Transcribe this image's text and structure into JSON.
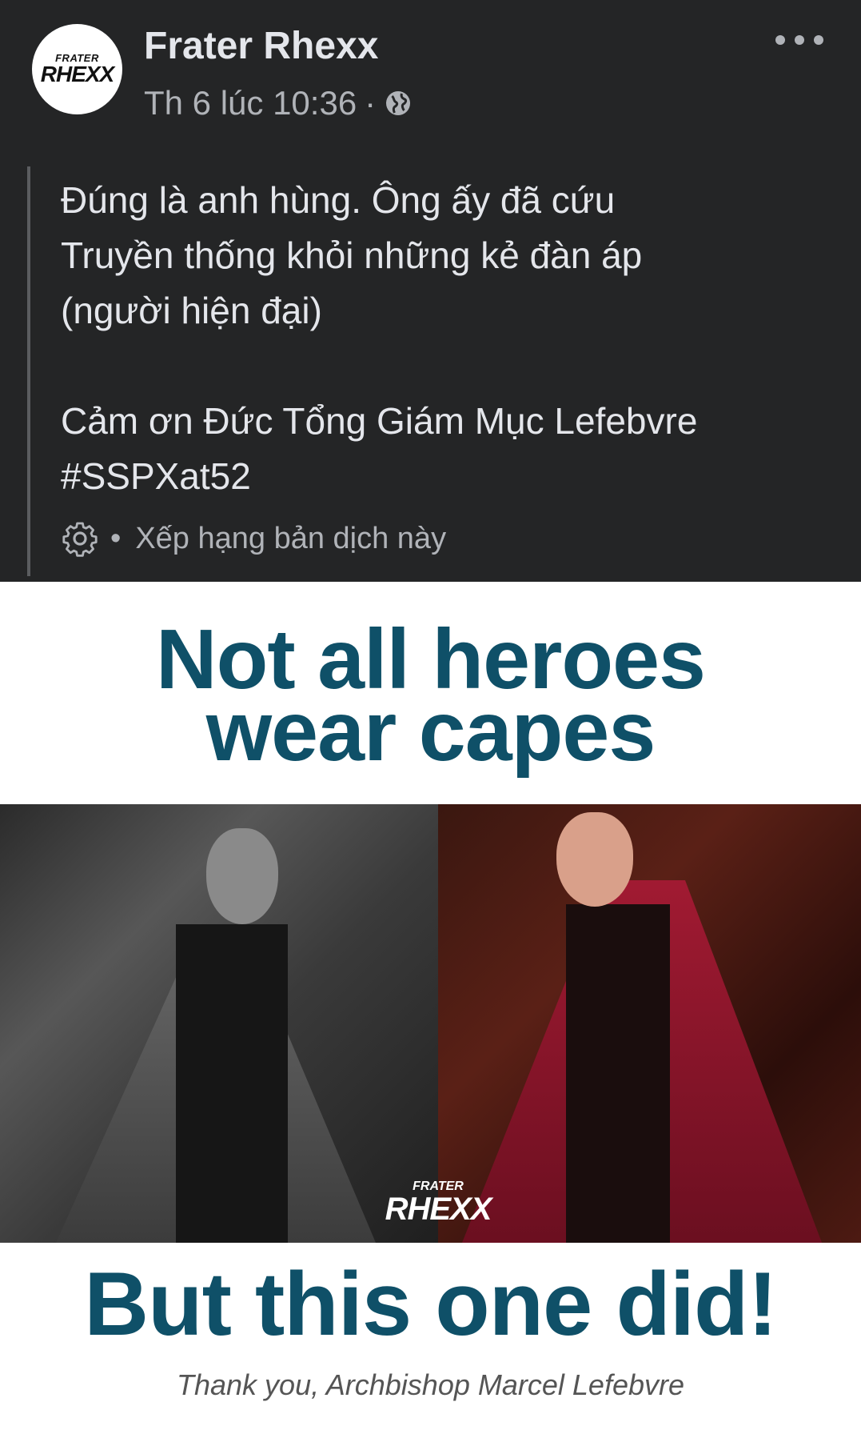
{
  "post": {
    "author": "Frater Rhexx",
    "timestamp": "Th 6 lúc 10:36",
    "privacy_icon": "globe-icon",
    "avatar_logo": {
      "top": "FRATER",
      "bottom": "RHEXX"
    },
    "text_lines": [
      "Đúng là anh hùng. Ông ấy đã cứu",
      "Truyền thống khỏi những kẻ đàn áp",
      "(người hiện đại)"
    ],
    "text_lines_2": [
      "Cảm ơn Đức Tổng Giám Mục Lefebvre",
      "#SSPXat52"
    ],
    "translation_rating": "Xếp hạng bản dịch này"
  },
  "image": {
    "headline_line1": "Not all heroes",
    "headline_line2": "wear capes",
    "watermark_top": "FRATER",
    "watermark_bottom": "RHEXX",
    "subheadline": "But this one did!",
    "caption": "Thank you, Archbishop Marcel Lefebvre"
  },
  "colors": {
    "background": "#242526",
    "primary_text": "#e4e6eb",
    "secondary_text": "#b0b3b8",
    "poster_text": "#0f5068"
  }
}
